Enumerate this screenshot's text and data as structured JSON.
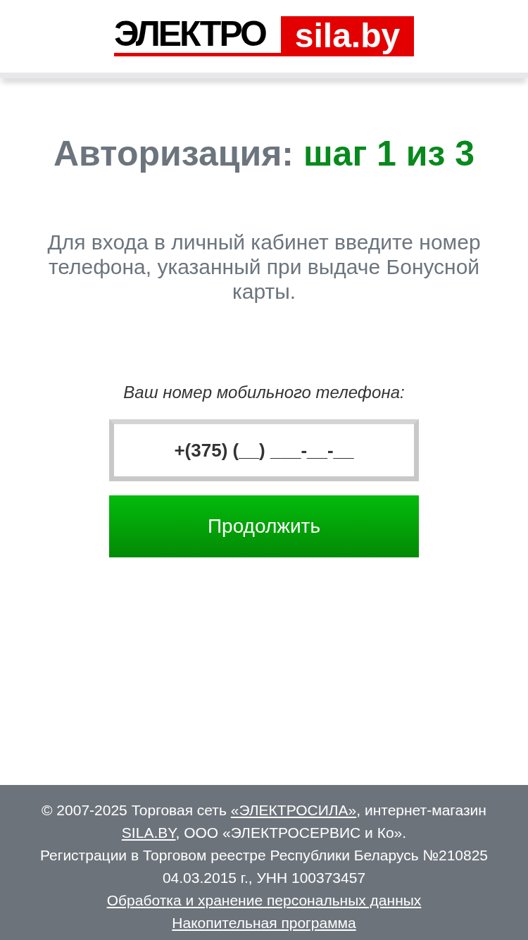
{
  "logo": {
    "word": "ЭЛЕКТРО",
    "domain": "sila.by"
  },
  "heading": {
    "label": "Авторизация:",
    "step": "шаг 1 из 3"
  },
  "description": "Для входа в личный кабинет введите номер телефона, указанный при выдаче Бонусной карты.",
  "phone_field": {
    "label": "Ваш номер мобильного телефона:",
    "value": "+(375) (__) ___-__-__"
  },
  "continue_button": "Продолжить",
  "footer": {
    "copyright": [
      {
        "text": "© 2007-2025 Торговая сеть ",
        "kind": "text"
      },
      {
        "text": "«ЭЛЕКТРОСИЛА»",
        "kind": "link"
      },
      {
        "text": ", интернет-магазин ",
        "kind": "text"
      },
      {
        "text": "SILA.BY",
        "kind": "link"
      },
      {
        "text": ", ООО «ЭЛЕКТРОСЕРВИС и Ко».",
        "kind": "text"
      }
    ],
    "registration": "Регистрации в Торговом реестре Республики Беларусь №210825 04.03.2015 г., УНН 100373457",
    "links": [
      "Обработка и хранение персональных данных",
      "Накопительная программа"
    ]
  }
}
